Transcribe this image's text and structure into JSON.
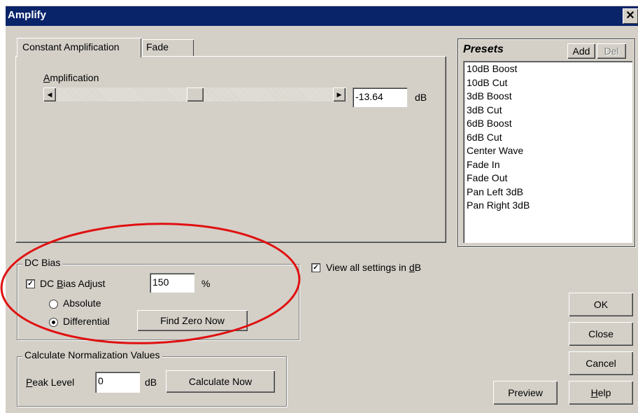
{
  "window": {
    "title": "Amplify",
    "close_glyph": "✕"
  },
  "tabs": [
    {
      "label": "Constant Amplification",
      "active": true
    },
    {
      "label": "Fade",
      "active": false
    }
  ],
  "amplification": {
    "label_first": "A",
    "label_rest": "mplification",
    "value": "-13.64",
    "unit": "dB",
    "slider_level": 0.5,
    "left_arrow": "◀",
    "right_arrow": "▶"
  },
  "presets": {
    "title": "Presets",
    "add_label": "Add",
    "del_label": "Del",
    "items": [
      "10dB Boost",
      "10dB Cut",
      "3dB Boost",
      "3dB Cut",
      "6dB Boost",
      "6dB Cut",
      "Center Wave",
      "Fade In",
      "Fade Out",
      "Pan Left 3dB",
      "Pan Right 3dB"
    ]
  },
  "view_all": {
    "label_pre": "View all settings in ",
    "label_u": "d",
    "label_post": "B",
    "checked": true
  },
  "dc_bias": {
    "group_label": "DC Bias",
    "adjust_label_pre": "DC ",
    "adjust_label_u": "B",
    "adjust_label_post": "ias Adjust",
    "adjust_checked": true,
    "value": "150",
    "unit": "%",
    "absolute_label": "Absolute",
    "differential_label": "Differential",
    "selected": "Differential",
    "find_zero_label": "Find Zero Now"
  },
  "normalization": {
    "group_label": "Calculate Normalization Values",
    "peak_label_u": "P",
    "peak_label_rest": "eak Level",
    "peak_value": "0",
    "unit": "dB",
    "calculate_label": "Calculate Now"
  },
  "buttons": {
    "ok": "OK",
    "close": "Close",
    "cancel": "Cancel",
    "preview": "Preview",
    "help_u": "H",
    "help_rest": "elp"
  },
  "annotation": {
    "color": "#e01010"
  }
}
